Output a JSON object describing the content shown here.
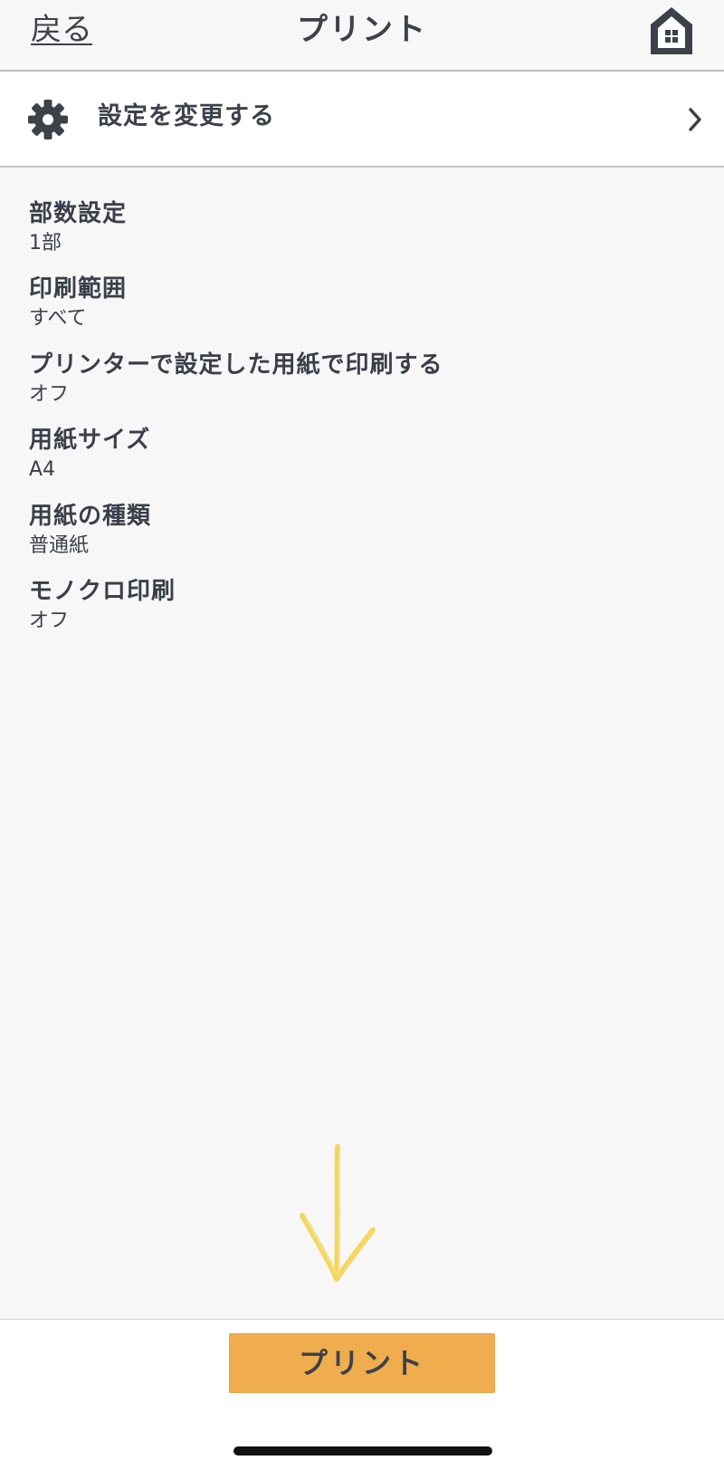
{
  "nav": {
    "back_label": "戻る",
    "title": "プリント"
  },
  "settings_link": {
    "label": "設定を変更する"
  },
  "settings": [
    {
      "name": "部数設定",
      "value": "1部"
    },
    {
      "name": "印刷範囲",
      "value": "すべて"
    },
    {
      "name": "プリンターで設定した用紙で印刷する",
      "value": "オフ"
    },
    {
      "name": "用紙サイズ",
      "value": "A4"
    },
    {
      "name": "用紙の種類",
      "value": "普通紙"
    },
    {
      "name": "モノクロ印刷",
      "value": "オフ"
    }
  ],
  "footer": {
    "print_label": "プリント"
  },
  "icons": {
    "home": "home-icon",
    "settings": "gear-icon",
    "chevron": "chevron-right-icon",
    "annotation": "arrow-down-annotation"
  },
  "colors": {
    "primary_button": "#f0ad4e",
    "text": "#3d414a",
    "annotation_arrow": "#f3d34f"
  }
}
